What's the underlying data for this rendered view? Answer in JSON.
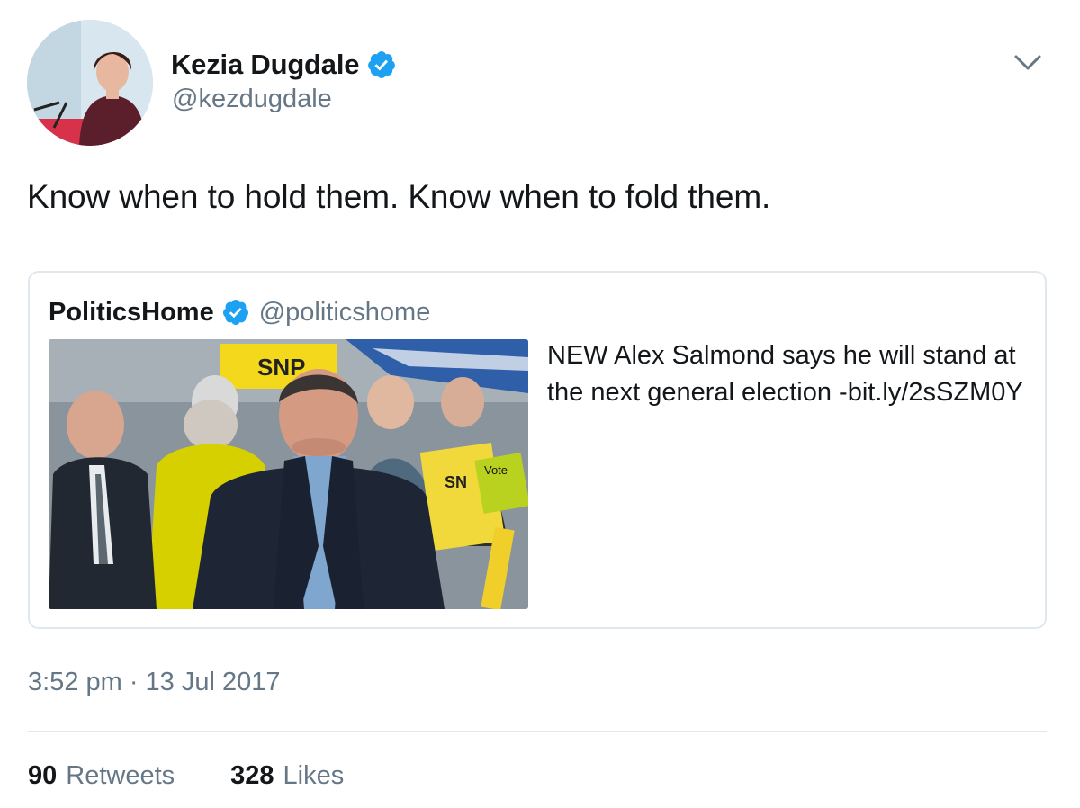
{
  "author": {
    "display_name": "Kezia Dugdale",
    "handle": "@kezdugdale",
    "verified_icon": "verified-badge-icon"
  },
  "tweet": {
    "text": "Know when to hold them. Know when to fold them.",
    "timestamp": "3:52 pm · 13 Jul 2017"
  },
  "quoted_tweet": {
    "display_name": "PoliticsHome",
    "handle": "@politicshome",
    "text": "NEW Alex Salmond says he will stand at the next general election -bit.ly/2sSZM0Y",
    "image_signs": {
      "sign1": "SNP",
      "sign2": "SN",
      "sign3": "Vote"
    }
  },
  "stats": {
    "retweets_count": "90",
    "retweets_label": "Retweets",
    "likes_count": "328",
    "likes_label": "Likes"
  },
  "colors": {
    "verified_blue": "#1da1f2",
    "secondary_text": "#657786",
    "border": "#e1e8ed"
  }
}
